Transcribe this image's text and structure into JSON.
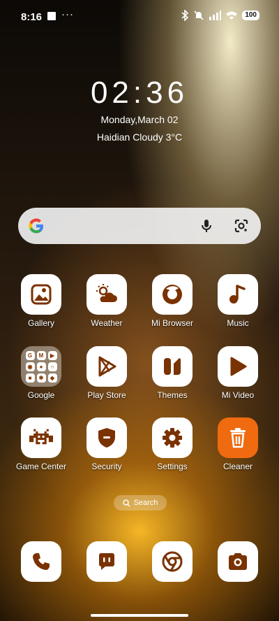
{
  "status_bar": {
    "time": "8:16",
    "battery": "100",
    "icons": [
      "notification-square-icon",
      "more-dots-icon",
      "bluetooth-icon",
      "silent-mode-icon",
      "signal-icon",
      "wifi-icon",
      "battery-icon"
    ]
  },
  "clock": {
    "time": "02:36",
    "date": "Monday,March 02",
    "weather": "Haidian Cloudy 3°C"
  },
  "search_widget": {
    "icons": [
      "google-logo-icon",
      "mic-icon",
      "google-lens-icon"
    ]
  },
  "apps": [
    {
      "label": "Gallery",
      "icon": "gallery-icon"
    },
    {
      "label": "Weather",
      "icon": "weather-icon"
    },
    {
      "label": "Mi Browser",
      "icon": "browser-icon"
    },
    {
      "label": "Music",
      "icon": "music-note-icon"
    },
    {
      "label": "Google",
      "icon": "google-folder-icon"
    },
    {
      "label": "Play Store",
      "icon": "play-store-icon"
    },
    {
      "label": "Themes",
      "icon": "themes-icon"
    },
    {
      "label": "Mi Video",
      "icon": "video-play-icon"
    },
    {
      "label": "Game Center",
      "icon": "game-invader-icon"
    },
    {
      "label": "Security",
      "icon": "shield-icon"
    },
    {
      "label": "Settings",
      "icon": "gear-icon"
    },
    {
      "label": "Cleaner",
      "icon": "trash-icon"
    }
  ],
  "home_search": {
    "label": "Search"
  },
  "dock": [
    "phone-icon",
    "messages-icon",
    "chrome-icon",
    "camera-icon"
  ],
  "colors": {
    "accent": "#7a3200",
    "cleaner_bg": "#f06a10"
  }
}
